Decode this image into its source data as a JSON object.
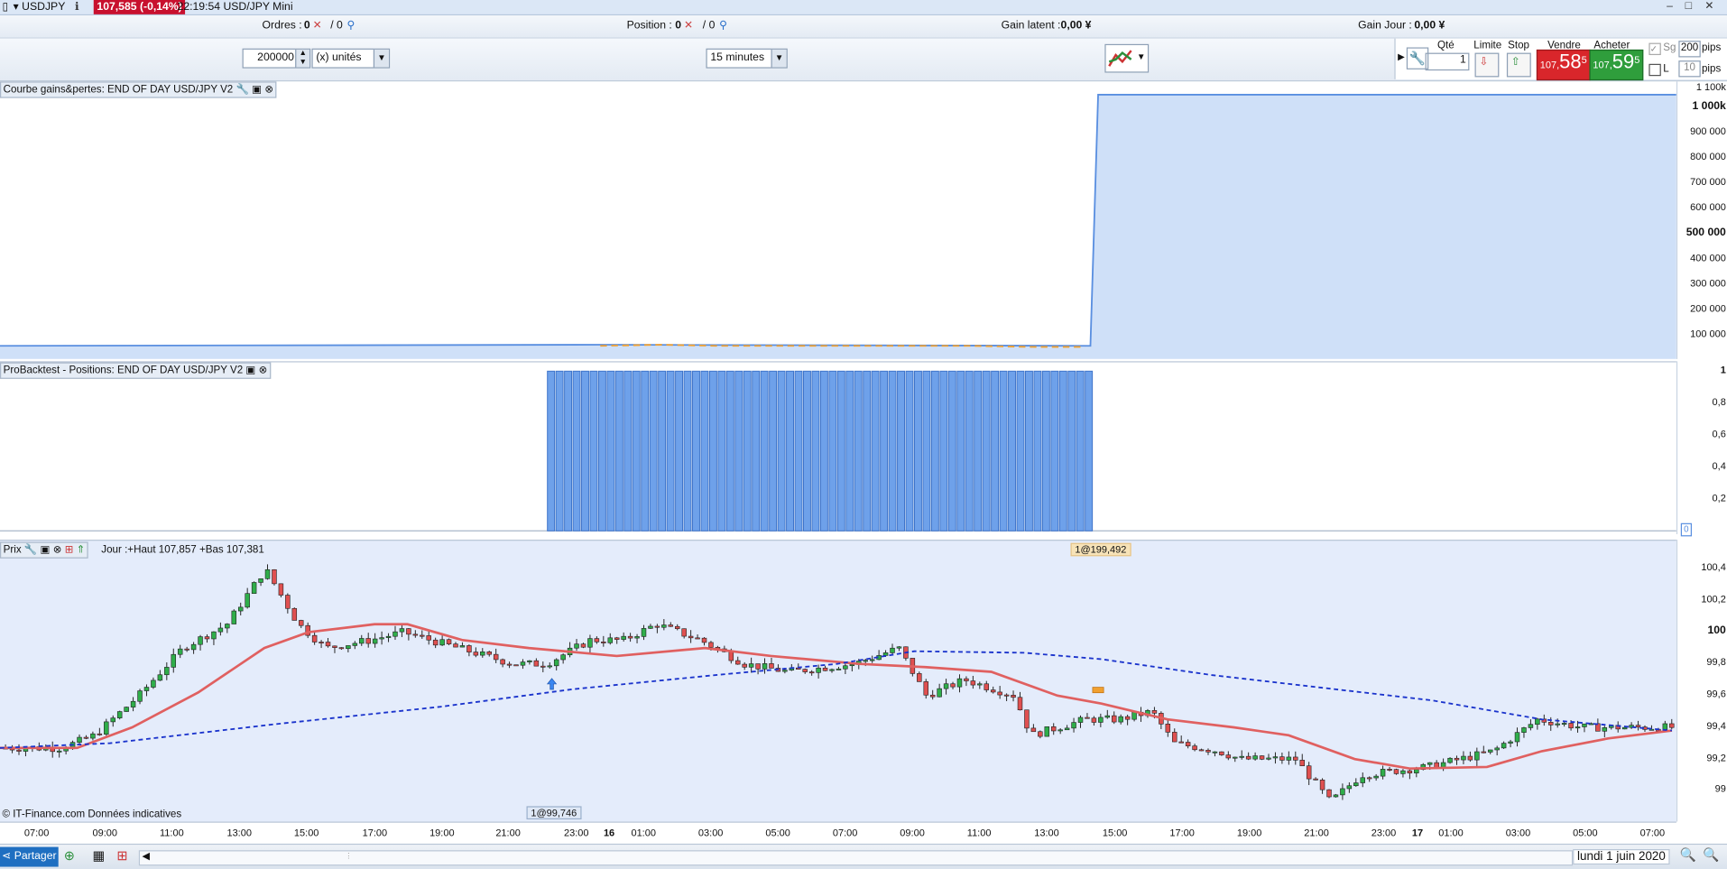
{
  "titlebar": {
    "symbol": "USDJPY",
    "price_badge": "107,585 (-0,14%)",
    "time_name": "22:19:54 USD/JPY Mini",
    "win_min": "–",
    "win_max": "□",
    "win_close": "✕"
  },
  "infobar": {
    "orders_label": "Ordres :",
    "orders_value": "0",
    "orders_value2": "/ 0",
    "position_label": "Position :",
    "position_value": "0",
    "position_value2": "/ 0",
    "latent_label": "Gain latent :",
    "latent_value": "0,00 ¥",
    "day_label": "Gain Jour :",
    "day_value": "0,00 ¥"
  },
  "toolbar": {
    "quantity": "200000",
    "units": "(x) unités",
    "timeframe": "15 minutes",
    "qty_label": "Qté",
    "qty_value": "1",
    "limit_label": "Limite",
    "stop_label": "Stop",
    "sell_label": "Vendre",
    "buy_label": "Acheter",
    "sell_price_small": "107,",
    "sell_price_big": "58",
    "sell_price_sup": "5",
    "buy_price_small": "107,",
    "buy_price_big": "59",
    "buy_price_sup": "5",
    "sg_label": "Sg",
    "sg_value": "200",
    "sg_unit": "pips",
    "l_label": "L",
    "l_value": "10",
    "l_unit": "pips"
  },
  "pane1": {
    "label": "Courbe gains&pertes: END OF DAY USD/JPY V2",
    "axis": [
      "1 100k",
      "1 000k",
      "900 000",
      "800 000",
      "700 000",
      "600 000",
      "500 000",
      "400 000",
      "300 000",
      "200 000",
      "100 000"
    ]
  },
  "pane2": {
    "label": "ProBacktest - Positions: END OF DAY USD/JPY V2",
    "axis": [
      "1",
      "0,8",
      "0,6",
      "0,4",
      "0,2",
      "0"
    ]
  },
  "pane3": {
    "label": "Prix",
    "summary": "Jour :+Haut 107,857 +Bas 107,381",
    "entry_marker": "1@99,746",
    "exit_marker": "1@199,492",
    "axis": [
      "100,4",
      "100,2",
      "100",
      "99,8",
      "99,6",
      "99,4",
      "99,2",
      "99"
    ],
    "copyright": "© IT-Finance.com Données indicatives"
  },
  "time_axis": [
    "07:00",
    "09:00",
    "11:00",
    "13:00",
    "15:00",
    "17:00",
    "19:00",
    "21:00",
    "23:00",
    "16",
    "01:00",
    "03:00",
    "05:00",
    "07:00",
    "09:00",
    "11:00",
    "13:00",
    "15:00",
    "17:00",
    "19:00",
    "21:00",
    "23:00",
    "17",
    "01:00",
    "03:00",
    "05:00",
    "07:00"
  ],
  "bottombar": {
    "share": "Partager",
    "date": "lundi 1 juin 2020"
  }
}
